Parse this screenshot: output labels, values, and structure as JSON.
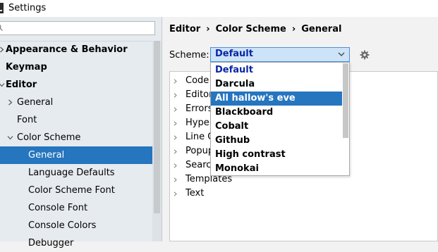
{
  "window": {
    "title": "Settings"
  },
  "sidebar": {
    "search_placeholder": "",
    "items": [
      {
        "label": "Appearance & Behavior",
        "indent": 0,
        "bold": true,
        "arrow": "right"
      },
      {
        "label": "Keymap",
        "indent": 0,
        "bold": true,
        "arrow": "none"
      },
      {
        "label": "Editor",
        "indent": 0,
        "bold": true,
        "arrow": "down"
      },
      {
        "label": "General",
        "indent": 1,
        "bold": false,
        "arrow": "right"
      },
      {
        "label": "Font",
        "indent": 1,
        "bold": false,
        "arrow": "none"
      },
      {
        "label": "Color Scheme",
        "indent": 1,
        "bold": false,
        "arrow": "down"
      },
      {
        "label": "General",
        "indent": 2,
        "bold": false,
        "arrow": "none",
        "selected": true
      },
      {
        "label": "Language Defaults",
        "indent": 2,
        "bold": false,
        "arrow": "none"
      },
      {
        "label": "Color Scheme Font",
        "indent": 2,
        "bold": false,
        "arrow": "none"
      },
      {
        "label": "Console Font",
        "indent": 2,
        "bold": false,
        "arrow": "none"
      },
      {
        "label": "Console Colors",
        "indent": 2,
        "bold": false,
        "arrow": "none"
      },
      {
        "label": "Debugger",
        "indent": 2,
        "bold": false,
        "arrow": "none"
      }
    ]
  },
  "breadcrumb": {
    "part1": "Editor",
    "part2": "Color Scheme",
    "part3": "General",
    "separator": "›"
  },
  "scheme": {
    "label": "Scheme:",
    "value": "Default"
  },
  "categories": [
    {
      "label": "Code"
    },
    {
      "label": "Editor"
    },
    {
      "label": "Errors"
    },
    {
      "label": "Hyper"
    },
    {
      "label": "Line C"
    },
    {
      "label": "Popup"
    },
    {
      "label": "Search"
    },
    {
      "label": "Templates"
    },
    {
      "label": "Text"
    }
  ],
  "dropdown": {
    "options": [
      "Default",
      "Darcula",
      "All hallow's eve",
      "Blackboard",
      "Cobalt",
      "Github",
      "High contrast",
      "Monokai"
    ],
    "highlighted_index": 2
  },
  "colors": {
    "accent": "#2675bf",
    "scheme_text": "#0a26a6",
    "combo_bg": "#cde3f8"
  }
}
